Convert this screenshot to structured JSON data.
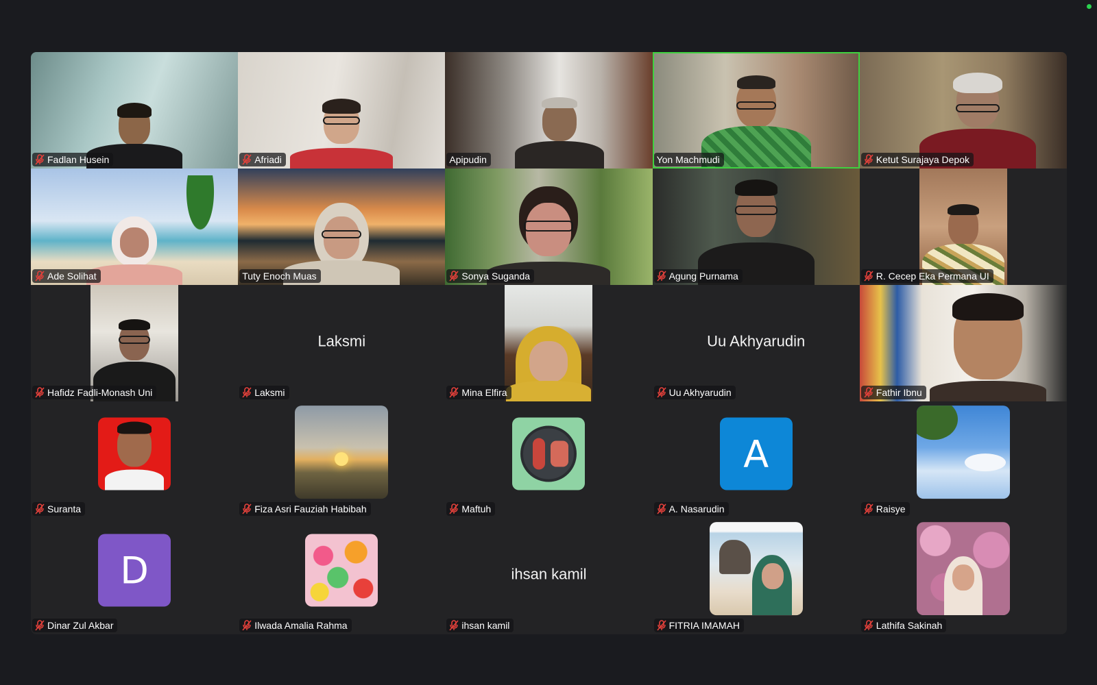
{
  "meeting": {
    "status_color": "#2bd24f",
    "active_speaker": "Yon Machmudi",
    "muted_icon": "microphone-muted-icon"
  },
  "participants": [
    {
      "name": "Fadlan Husein",
      "muted": true,
      "view": "video"
    },
    {
      "name": "Afriadi",
      "muted": true,
      "view": "video"
    },
    {
      "name": "Apipudin",
      "muted": false,
      "view": "video"
    },
    {
      "name": "Yon Machmudi",
      "muted": false,
      "view": "video",
      "active": true
    },
    {
      "name": "Ketut Surajaya Depok",
      "muted": true,
      "view": "video"
    },
    {
      "name": "Ade Solihat",
      "muted": true,
      "view": "video"
    },
    {
      "name": "Tuty Enoch Muas",
      "muted": false,
      "view": "video"
    },
    {
      "name": "Sonya Suganda",
      "muted": true,
      "view": "video"
    },
    {
      "name": "Agung Purnama",
      "muted": true,
      "view": "video"
    },
    {
      "name": "R. Cecep Eka Permana UI",
      "muted": true,
      "view": "video"
    },
    {
      "name": "Hafidz Fadli-Monash Uni",
      "muted": true,
      "view": "video"
    },
    {
      "name": "Laksmi",
      "muted": true,
      "view": "name",
      "display_name": "Laksmi"
    },
    {
      "name": "Mina Elfira",
      "muted": true,
      "view": "video"
    },
    {
      "name": "Uu Akhyarudin",
      "muted": true,
      "view": "name",
      "display_name": "Uu Akhyarudin"
    },
    {
      "name": "Fathir Ibnu",
      "muted": true,
      "view": "video"
    },
    {
      "name": "Suranta",
      "muted": true,
      "view": "avatar"
    },
    {
      "name": "Fiza Asri Fauziah Habibah",
      "muted": true,
      "view": "avatar"
    },
    {
      "name": "Maftuh",
      "muted": true,
      "view": "avatar"
    },
    {
      "name": "A. Nasarudin",
      "muted": true,
      "view": "avatar",
      "letter": "A",
      "color": "#0d87d7"
    },
    {
      "name": "Raisye",
      "muted": true,
      "view": "avatar"
    },
    {
      "name": "Dinar Zul Akbar",
      "muted": true,
      "view": "avatar",
      "letter": "D",
      "color": "#7f57c7"
    },
    {
      "name": "Ilwada Amalia Rahma",
      "muted": true,
      "view": "avatar"
    },
    {
      "name": "ihsan kamil",
      "muted": true,
      "view": "name",
      "display_name": "ihsan kamil"
    },
    {
      "name": "FITRIA IMAMAH",
      "muted": true,
      "view": "avatar"
    },
    {
      "name": "Lathifa Sakinah",
      "muted": true,
      "view": "avatar"
    }
  ]
}
